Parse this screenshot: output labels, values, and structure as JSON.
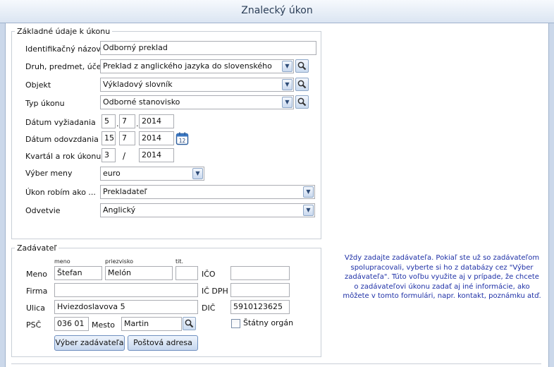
{
  "window": {
    "title": "Znalecký úkon"
  },
  "basic": {
    "legend": "Základné údaje k úkonu",
    "id_name": {
      "label": "Identifikačný názov",
      "value": "Odborný preklad"
    },
    "kind": {
      "label": "Druh, predmet, účel",
      "value": "Preklad z anglického jazyka do slovenského"
    },
    "object": {
      "label": "Objekt",
      "value": "Výkladový slovník"
    },
    "type": {
      "label": "Typ úkonu",
      "value": "Odborné stanovisko"
    },
    "requested": {
      "label": "Dátum vyžiadania",
      "day": "5",
      "month": "7",
      "year": "2014"
    },
    "delivered": {
      "label": "Dátum odovzdania",
      "day": "15",
      "month": "7",
      "year": "2014"
    },
    "quarter": {
      "label": "Kvartál a rok úkonu",
      "quarter": "3",
      "separator": "/",
      "year": "2014"
    },
    "currency": {
      "label": "Výber meny",
      "value": "euro"
    },
    "role": {
      "label": "Úkon robím ako ...",
      "value": "Prekladateľ"
    },
    "branch": {
      "label": "Odvetvie",
      "value": "Anglický"
    }
  },
  "client": {
    "legend": "Zadávateľ",
    "hint_name": "meno",
    "hint_surname": "priezvisko",
    "hint_title": "tit.",
    "name_label": "Meno",
    "first_name": "Štefan",
    "surname": "Melón",
    "title_value": "",
    "ico_label": "IČO",
    "ico_value": "",
    "firm_label": "Firma",
    "firm_value": "",
    "icdph_label": "IČ DPH",
    "icdph_value": "",
    "street_label": "Ulica",
    "street_value": "Hviezdoslavova 5",
    "dic_label": "DIČ",
    "dic_value": "5910123625",
    "psc_label": "PSČ",
    "psc_value": "036 01",
    "city_label": "Mesto",
    "city_value": "Martin",
    "state_org_label": "Štátny orgán",
    "state_org_checked": false,
    "select_button": "Výber zadávateľa",
    "postal_button": "Poštová adresa"
  },
  "info_text": "Vždy zadajte zadávateľa. Pokiaľ ste už so zadávateľom spolupracovali, vyberte si ho z databázy cez \"Výber zadávateľa\". Túto voľbu využite aj v prípade, že chcete o zadávateľovi úkonu zadať aj iné informácie, ako môžete v tomto formulári, napr. kontakt, poznámku atď.",
  "icons": {
    "dropdown": "chevron-down-icon",
    "search": "magnifier-icon",
    "calendar": "calendar-icon"
  }
}
